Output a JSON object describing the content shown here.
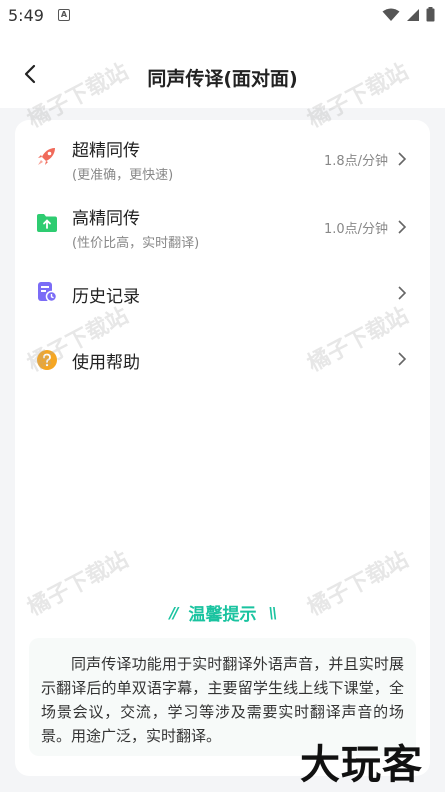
{
  "status_bar": {
    "time": "5:49",
    "app_icon_letter": "A"
  },
  "header": {
    "title": "同声传译(面对面)"
  },
  "menu": [
    {
      "label": "超精同传",
      "subtitle": "(更准确，更快速)",
      "price": "1.8点/分钟",
      "icon": "rocket-icon",
      "icon_color": "#f06a5a"
    },
    {
      "label": "高精同传",
      "subtitle": "(性价比高，实时翻译)",
      "price": "1.0点/分钟",
      "icon": "folder-upload-icon",
      "icon_color": "#2ecc71"
    },
    {
      "label": "历史记录",
      "icon": "history-record-icon",
      "icon_color": "#7b6cf6"
    },
    {
      "label": "使用帮助",
      "icon": "help-icon",
      "icon_color": "#f5a623"
    }
  ],
  "tips": {
    "title": "温馨提示",
    "body": "同声传译功能用于实时翻译外语声音，并且实时展示翻译后的单双语字幕，主要留学生线上线下课堂，全场景会议，交流，学习等涉及需要实时翻译声音的场景。用途广泛，实时翻译。"
  },
  "watermark_text": "橘子下载站",
  "brand_logo": "大玩客",
  "colors": {
    "accent": "#1ac3a0",
    "background": "#f4f5f7"
  }
}
